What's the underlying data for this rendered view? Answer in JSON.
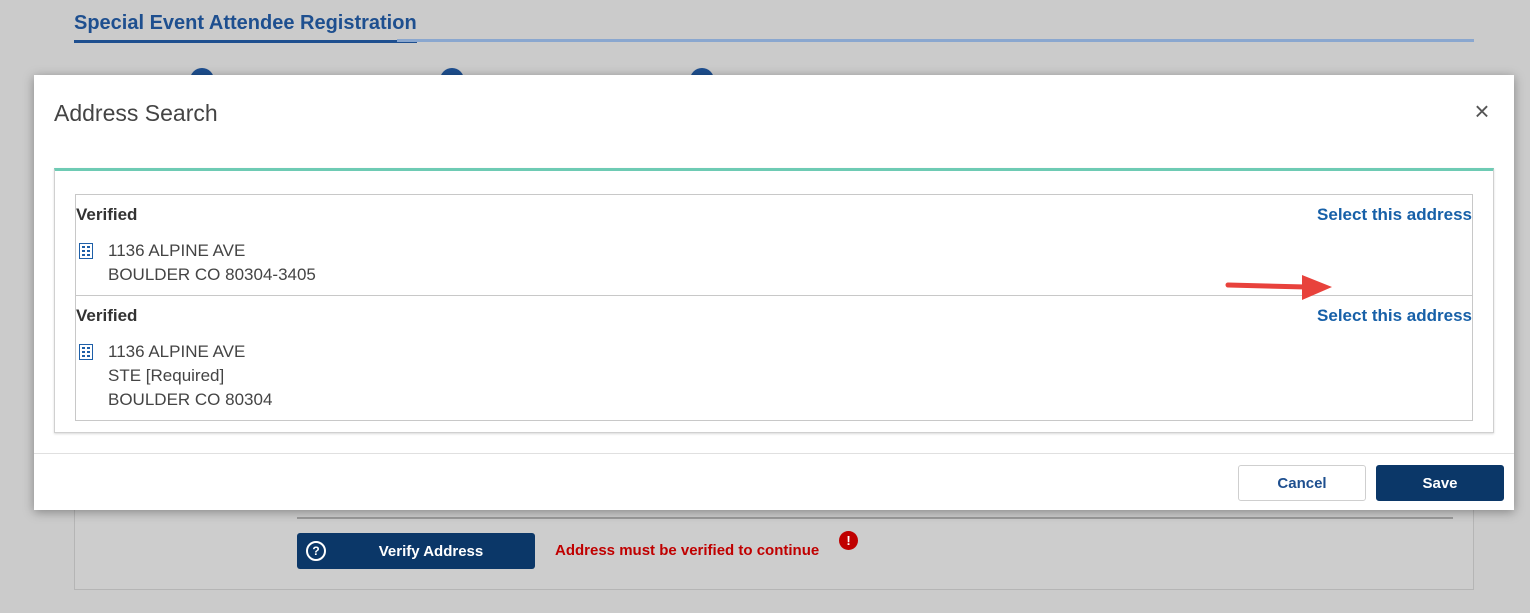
{
  "page": {
    "title": "Special Event Attendee Registration",
    "verify_button_label": "Verify Address",
    "verify_icon": "question-circle-icon",
    "warning_text": "Address must be verified to continue",
    "warning_icon_glyph": "!"
  },
  "modal": {
    "title": "Address Search",
    "close_glyph": "×",
    "results": [
      {
        "status": "Verified",
        "select_label": "Select this address",
        "lines": [
          "1136 ALPINE AVE",
          "BOULDER CO 80304-3405"
        ]
      },
      {
        "status": "Verified",
        "select_label": "Select this address",
        "lines": [
          "1136 ALPINE AVE",
          "STE [Required]",
          "BOULDER CO 80304"
        ]
      }
    ],
    "cancel_label": "Cancel",
    "save_label": "Save"
  },
  "colors": {
    "primary": "#0b3768",
    "link": "#1760a8",
    "accent_bar": "#6ecbb4",
    "error": "#c00000",
    "annotation_arrow": "#e8423c"
  }
}
